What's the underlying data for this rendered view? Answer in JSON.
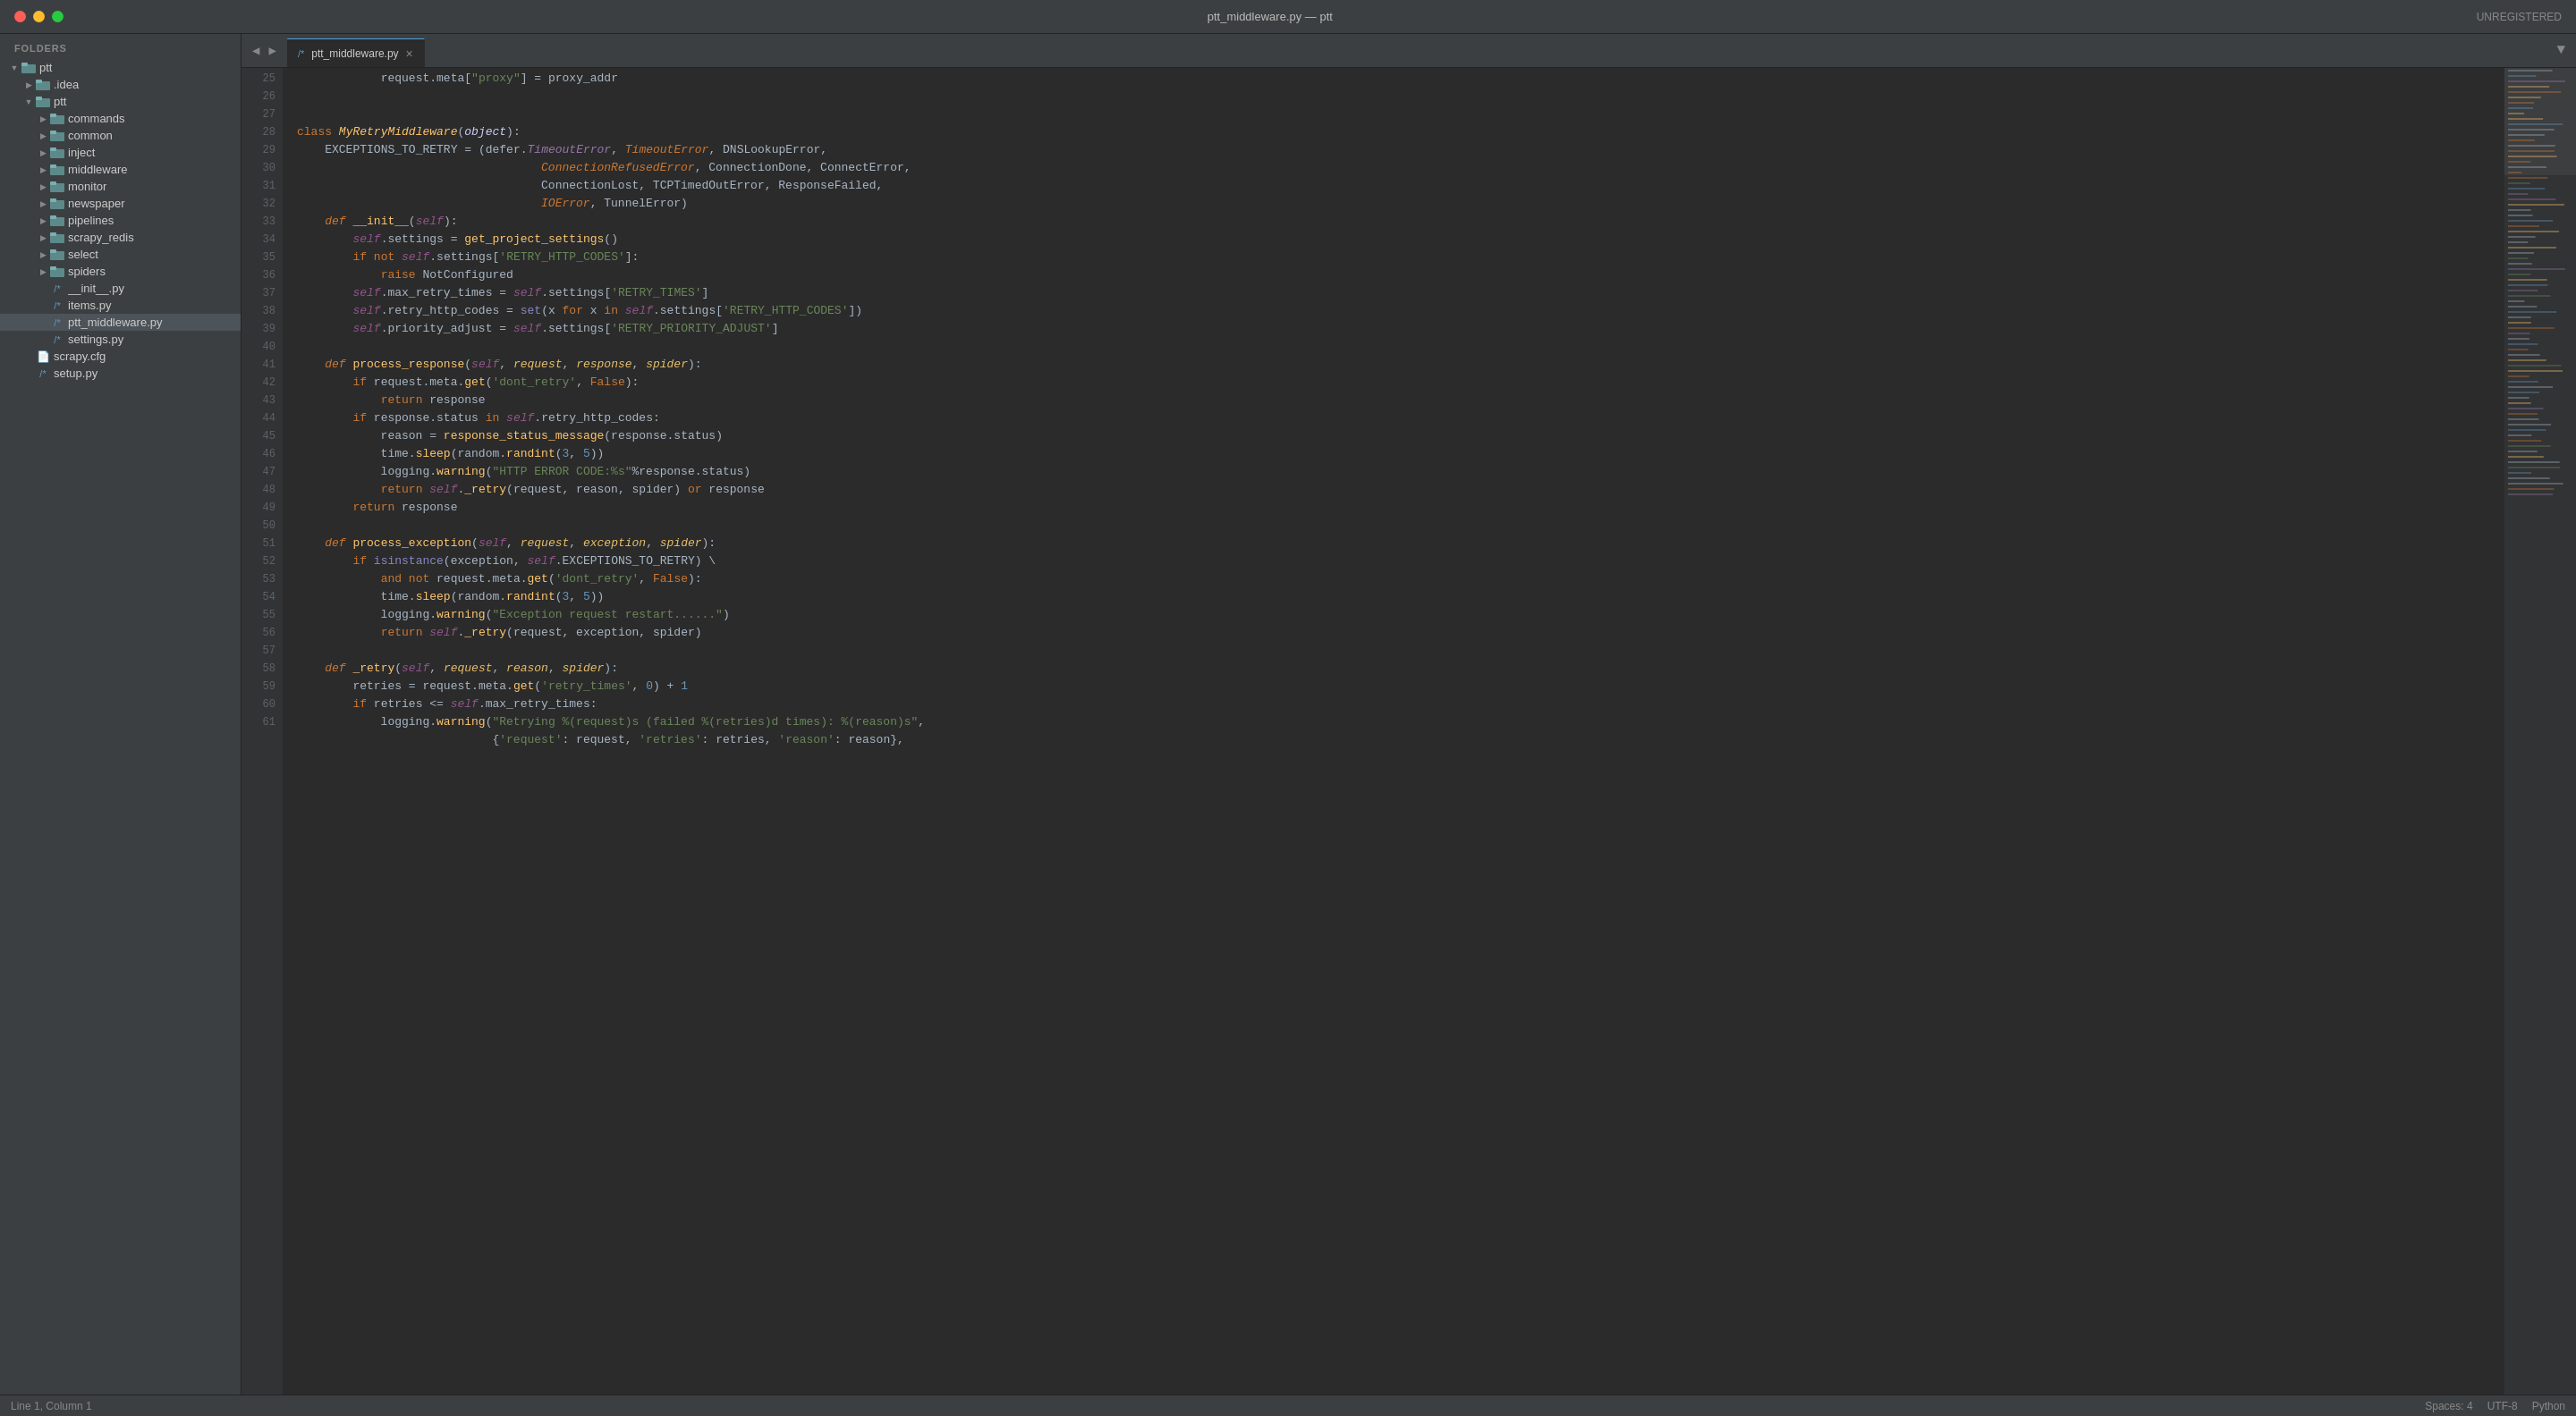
{
  "titlebar": {
    "title": "ptt_middleware.py — ptt",
    "unregistered": "UNREGISTERED"
  },
  "tab": {
    "filename": "ptt_middleware.py",
    "close_symbol": "×"
  },
  "sidebar": {
    "header": "FOLDERS",
    "root": "ptt",
    "items": [
      {
        "label": ".idea",
        "type": "folder",
        "depth": 1,
        "expanded": false
      },
      {
        "label": "ptt",
        "type": "folder",
        "depth": 1,
        "expanded": true
      },
      {
        "label": "commands",
        "type": "folder",
        "depth": 2,
        "expanded": false
      },
      {
        "label": "common",
        "type": "folder",
        "depth": 2,
        "expanded": false
      },
      {
        "label": "inject",
        "type": "folder",
        "depth": 2,
        "expanded": false
      },
      {
        "label": "middleware",
        "type": "folder",
        "depth": 2,
        "expanded": false
      },
      {
        "label": "monitor",
        "type": "folder",
        "depth": 2,
        "expanded": false
      },
      {
        "label": "newspaper",
        "type": "folder",
        "depth": 2,
        "expanded": false
      },
      {
        "label": "pipelines",
        "type": "folder",
        "depth": 2,
        "expanded": false
      },
      {
        "label": "scrapy_redis",
        "type": "folder",
        "depth": 2,
        "expanded": false
      },
      {
        "label": "select",
        "type": "folder",
        "depth": 2,
        "expanded": false
      },
      {
        "label": "spiders",
        "type": "folder",
        "depth": 2,
        "expanded": false
      },
      {
        "label": "__init__.py",
        "type": "file",
        "depth": 2
      },
      {
        "label": "items.py",
        "type": "file",
        "depth": 2
      },
      {
        "label": "ptt_middleware.py",
        "type": "file",
        "depth": 2,
        "selected": true
      },
      {
        "label": "settings.py",
        "type": "file",
        "depth": 2
      },
      {
        "label": "scrapy.cfg",
        "type": "file-plain",
        "depth": 1
      },
      {
        "label": "setup.py",
        "type": "file",
        "depth": 1
      }
    ]
  },
  "status": {
    "left": "Line 1, Column 1",
    "spaces": "Spaces: 4",
    "encoding": "UTF-8",
    "language": "Python"
  }
}
